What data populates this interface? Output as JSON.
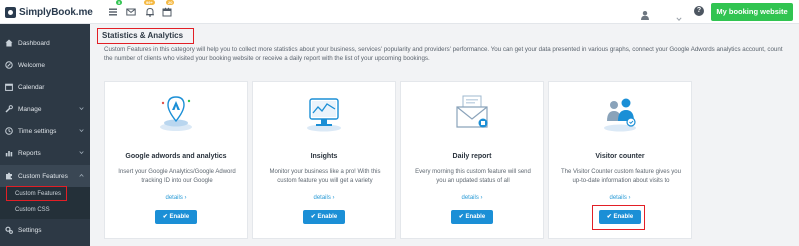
{
  "brand": {
    "logo_text": "SimplyBook.me"
  },
  "topbar": {
    "icons": [
      {
        "name": "list-icon",
        "badge": "5",
        "badge_color": "#31c451"
      },
      {
        "name": "mail-icon",
        "badge": "",
        "badge_color": ""
      },
      {
        "name": "bell-icon",
        "badge": "99+",
        "badge_color": "#f5b942"
      },
      {
        "name": "calendar-icon",
        "badge": "20",
        "badge_color": "#f5b942"
      }
    ],
    "help_label": "?",
    "my_booking_label": "My booking website"
  },
  "sidebar": {
    "items": [
      {
        "label": "Dashboard",
        "icon": "dashboard-icon"
      },
      {
        "label": "Welcome",
        "icon": "rocket-icon"
      },
      {
        "label": "Calendar",
        "icon": "calendar-icon"
      },
      {
        "label": "Manage",
        "icon": "wrench-icon"
      },
      {
        "label": "Time settings",
        "icon": "clock-icon"
      },
      {
        "label": "Reports",
        "icon": "bar-chart-icon"
      },
      {
        "label": "Custom Features",
        "icon": "puzzle-icon"
      },
      {
        "label": "Settings",
        "icon": "gears-icon"
      }
    ],
    "sub_items": [
      {
        "label": "Custom Features"
      },
      {
        "label": "Custom CSS"
      }
    ]
  },
  "main": {
    "section_title": "Statistics & Analytics",
    "intro": "Custom Features in this category will help you to collect more statistics about your business, services' popularity and providers' performance. You can get your data presented in various graphs, connect your Google Adwords analytics account, count the number of clients who visited your booking website or receive a daily report with the list of your upcoming bookings.",
    "cards": [
      {
        "title": "Google adwords and analytics",
        "description": "Insert your Google Analytics/Google Adword tracking ID into our Google",
        "details": "details",
        "enable": "Enable",
        "icon": "google-analytics-illustration"
      },
      {
        "title": "Insights",
        "description": "Monitor your business like a pro! With this custom feature you will get a variety",
        "details": "details",
        "enable": "Enable",
        "icon": "insights-monitor-illustration"
      },
      {
        "title": "Daily report",
        "description": "Every morning this custom feature will send you an updated status of all",
        "details": "details",
        "enable": "Enable",
        "icon": "daily-report-envelope-illustration"
      },
      {
        "title": "Visitor counter",
        "description": "The Visitor Counter custom feature gives you up-to-date information about visits to",
        "details": "details",
        "enable": "Enable",
        "icon": "visitor-counter-illustration"
      }
    ]
  },
  "colors": {
    "sidebar_bg": "#2d3945",
    "accent_green": "#31c451",
    "accent_blue": "#1b8fd6",
    "highlight_red": "#e21f26"
  }
}
